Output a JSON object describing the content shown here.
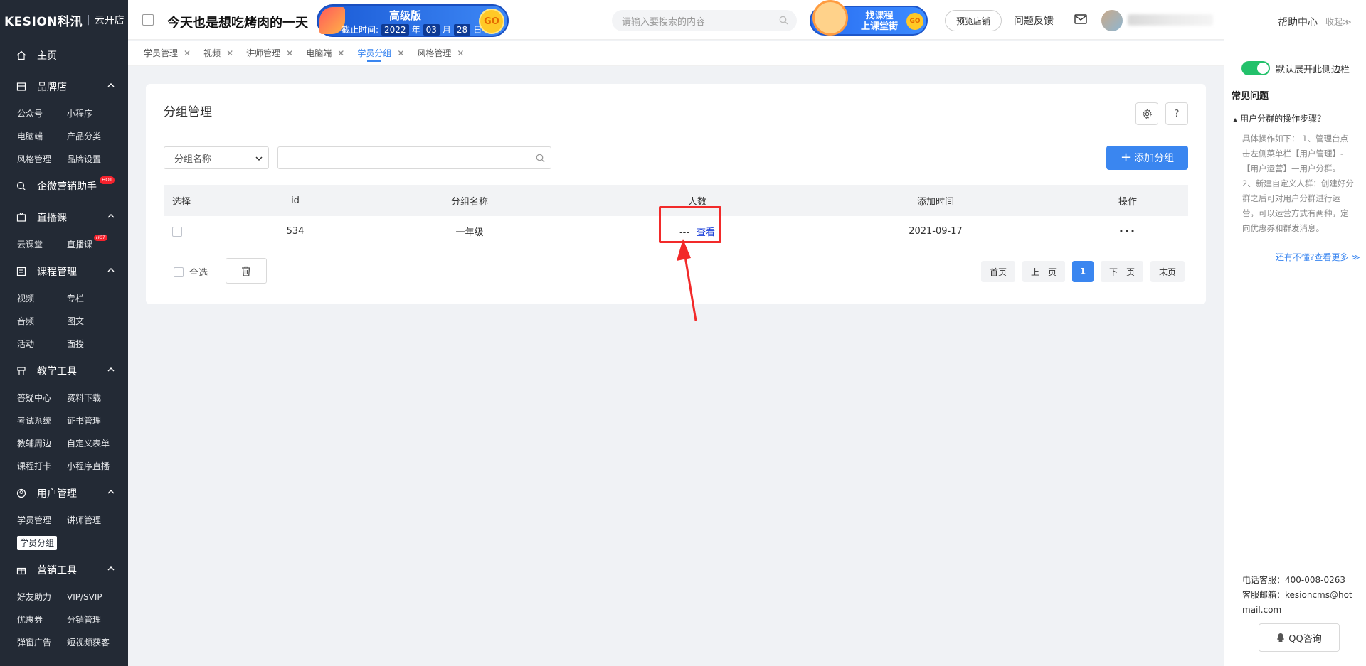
{
  "brand": {
    "logo": "KESION科汛",
    "product": "云开店"
  },
  "sidebar": {
    "home": "主页",
    "groups": [
      {
        "title": "品牌店",
        "items": [
          "公众号",
          "小程序",
          "电脑端",
          "产品分类",
          "风格管理",
          "品牌设置"
        ]
      },
      {
        "title": "企微营销助手",
        "hot": "HOT"
      },
      {
        "title": "直播课",
        "items": [
          "云课堂",
          "直播课"
        ]
      },
      {
        "title": "课程管理",
        "items": [
          "视频",
          "专栏",
          "音频",
          "图文",
          "活动",
          "面授"
        ]
      },
      {
        "title": "教学工具",
        "items": [
          "答疑中心",
          "资料下载",
          "考试系统",
          "证书管理",
          "教辅周边",
          "自定义表单",
          "课程打卡",
          "小程序直播"
        ]
      },
      {
        "title": "用户管理",
        "items": [
          "学员管理",
          "讲师管理",
          "学员分组"
        ]
      },
      {
        "title": "营销工具",
        "items": [
          "好友助力",
          "VIP/SVIP",
          "优惠券",
          "分销管理",
          "弹窗广告",
          "短视频获客"
        ]
      }
    ],
    "hot_small": "HOT"
  },
  "header": {
    "shop_name": "今天也是想吃烤肉的一天",
    "version_badge": {
      "title": "高级版",
      "deadline_label": "截止时间:",
      "year": "2022",
      "year_unit": "年",
      "month": "03",
      "month_unit": "月",
      "day": "28",
      "day_unit": "日",
      "go": "GO"
    },
    "search_placeholder": "请输入要搜索的内容",
    "course_badge": {
      "line1": "找课程",
      "line2": "上课堂街",
      "go": "GO"
    },
    "preview_button": "预览店铺",
    "feedback": "问题反馈"
  },
  "tabs": [
    {
      "label": "学员管理",
      "active": false
    },
    {
      "label": "视频",
      "active": false
    },
    {
      "label": "讲师管理",
      "active": false
    },
    {
      "label": "电脑端",
      "active": false
    },
    {
      "label": "学员分组",
      "active": true
    },
    {
      "label": "风格管理",
      "active": false
    }
  ],
  "page": {
    "title": "分组管理",
    "settings_icon": "gear-icon",
    "help_button": "?",
    "filter_select": "分组名称",
    "add_button": "添加分组",
    "columns": [
      "选择",
      "id",
      "分组名称",
      "人数",
      "添加时间",
      "操作"
    ],
    "rows": [
      {
        "id": "534",
        "name": "一年级",
        "count": "---",
        "view": "查看",
        "time": "2021-09-17",
        "ops": "···"
      }
    ],
    "select_all": "全选",
    "pager": {
      "first": "首页",
      "prev": "上一页",
      "current": "1",
      "next": "下一页",
      "last": "末页"
    }
  },
  "help_panel": {
    "help_center": "帮助中心",
    "collapse": "收起≫",
    "toggle_label": "默认展开此侧边栏",
    "faq_title": "常见问题",
    "question": "用户分群的操作步骤？",
    "answer": "具体操作如下： 1、管理台点击左侧菜单栏【用户管理】-【用户运营】—用户分群。 2、新建自定义人群：创建好分群之后可对用户分群进行运营，可以运营方式有两种，定向优惠券和群发消息。",
    "more_link": "还有不懂?查看更多 ≫",
    "phone": "电话客服：400-008-0263",
    "email": "客服邮箱：kesioncms@hotmail.com",
    "qq_button": "QQ咨询"
  },
  "colors": {
    "sidebar_bg": "#232a35",
    "primary": "#3a86f0",
    "annotation": "#f22a2a",
    "toggle_on": "#23c16b"
  }
}
